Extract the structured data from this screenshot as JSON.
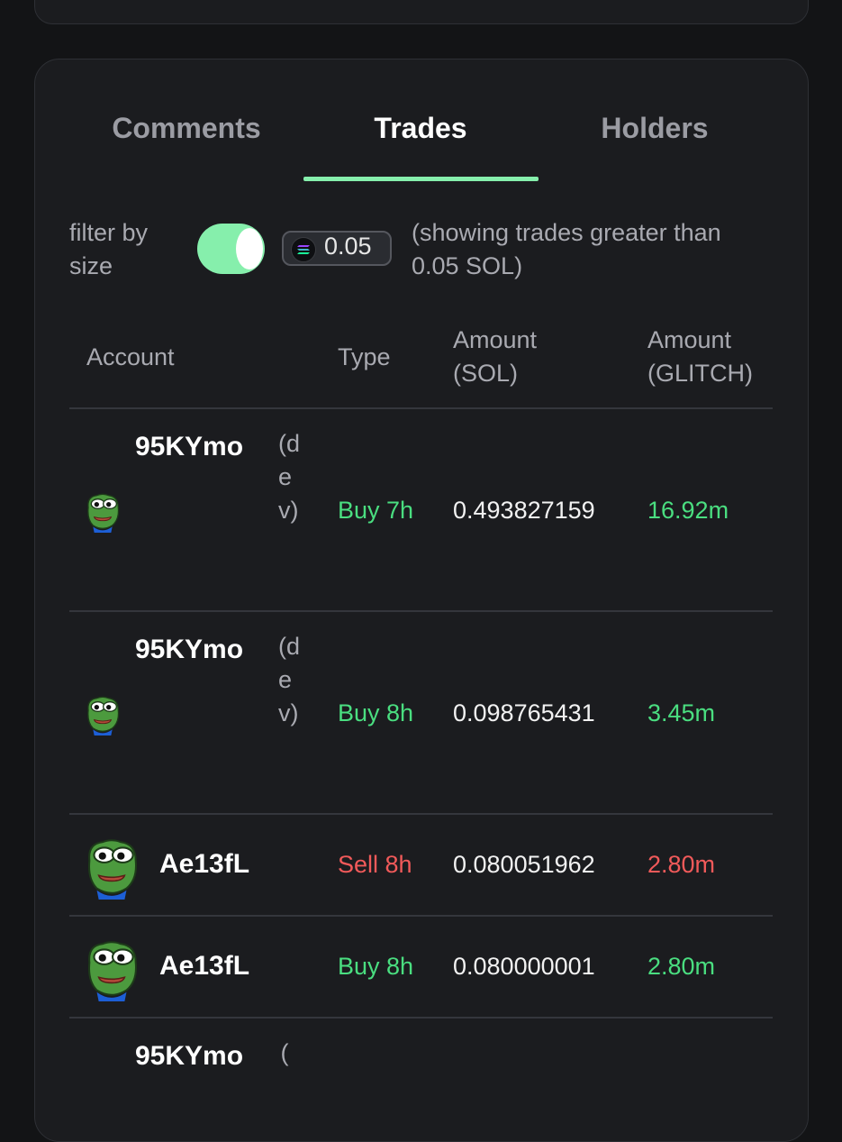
{
  "tabs": [
    {
      "label": "Comments",
      "active": false
    },
    {
      "label": "Trades",
      "active": true
    },
    {
      "label": "Holders",
      "active": false
    }
  ],
  "filter": {
    "label": "filter by size",
    "toggle_on": true,
    "value": "0.05",
    "description": "(showing trades greater than 0.05 SOL)"
  },
  "table": {
    "headers": [
      "Account",
      "Type",
      "Amount (SOL)",
      "Amount (GLITCH)"
    ],
    "rows": [
      {
        "account": "95KYmo",
        "tag": "(dev)",
        "type": "Buy 7h",
        "amount_sol": "0.493827159",
        "amount_token": "16.92m",
        "side": "buy"
      },
      {
        "account": "95KYmo",
        "tag": "(dev)",
        "type": "Buy 8h",
        "amount_sol": "0.098765431",
        "amount_token": "3.45m",
        "side": "buy"
      },
      {
        "account": "Ae13fL",
        "tag": "",
        "type": "Sell 8h",
        "amount_sol": "0.080051962",
        "amount_token": "2.80m",
        "side": "sell"
      },
      {
        "account": "Ae13fL",
        "tag": "",
        "type": "Buy 8h",
        "amount_sol": "0.080000001",
        "amount_token": "2.80m",
        "side": "buy"
      },
      {
        "account": "95KYmo",
        "tag": "(",
        "type": "",
        "amount_sol": "",
        "amount_token": "",
        "side": "buy"
      }
    ]
  },
  "colors": {
    "accent": "#86efac",
    "buy": "#4ade80",
    "sell": "#f15a5a",
    "background": "#131416",
    "card": "#1b1c1f"
  },
  "icons": {
    "avatar": "pepe-frog-avatar-icon",
    "sol": "solana-icon"
  }
}
